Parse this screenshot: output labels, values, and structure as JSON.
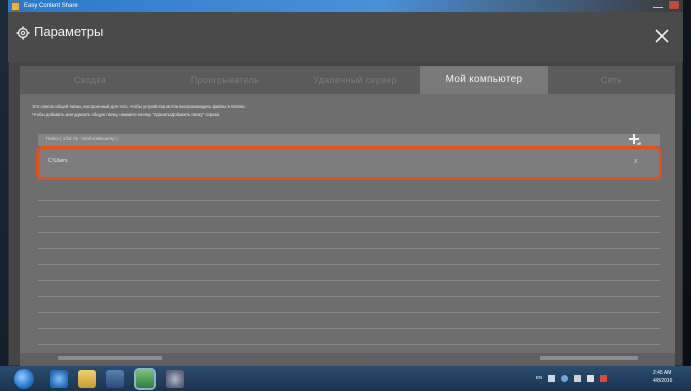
{
  "window": {
    "title": "Easy Content Share"
  },
  "dialog": {
    "title": "Параметры"
  },
  "tabs": [
    {
      "label": "Сводка",
      "active": false
    },
    {
      "label": "Проигрыватель",
      "active": false
    },
    {
      "label": "Удаленный сервер",
      "active": false
    },
    {
      "label": "Мой компьютер",
      "active": true
    },
    {
      "label": "Сеть",
      "active": false
    }
  ],
  "info": {
    "line1": "Это список общей папки, настроенный для того, чтобы устройства могли воспроизводить файлы в папках.",
    "line2": "Чтобы добавить или удалить общую папку, нажмите кнопку \"Удалить/Добавить папку\" справа."
  },
  "folders_table": {
    "header_label": "Папка  ( 1/16 ГБ · Мой компьютер )",
    "rows": [
      {
        "path": "C:\\Users",
        "remove_label": "x"
      }
    ]
  },
  "taskbar": {
    "clock_time": "2:45 AM",
    "clock_date": "4/8/2016",
    "language": "EN"
  },
  "colors": {
    "highlight": "#e0521c",
    "active_tab": "#7a7a7a",
    "panel": "#6e6e6e"
  },
  "icons": {
    "settings": "gear-icon",
    "close": "close-icon",
    "add": "add-folder-icon",
    "remove": "remove-icon"
  }
}
